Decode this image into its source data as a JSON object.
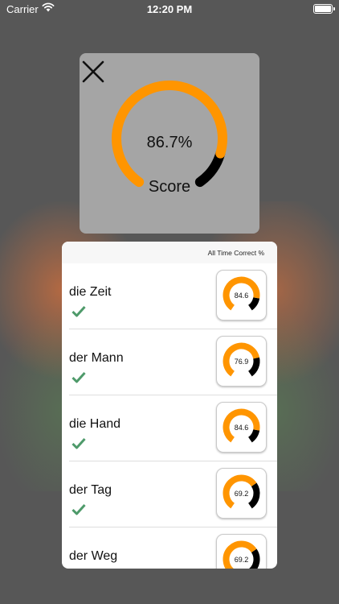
{
  "status_bar": {
    "carrier": "Carrier",
    "time": "12:20 PM",
    "wifi_icon": "wifi-icon",
    "battery_icon": "battery-icon"
  },
  "score": {
    "value": "86.7%",
    "label": "Score",
    "fraction": 0.867,
    "close_icon": "close-icon"
  },
  "stats": {
    "header": "All Time Correct %",
    "rows": [
      {
        "word": "die Zeit",
        "correct_pct": "84.6",
        "fraction": 0.846,
        "correct": true
      },
      {
        "word": "der Mann",
        "correct_pct": "76.9",
        "fraction": 0.769,
        "correct": true
      },
      {
        "word": "die Hand",
        "correct_pct": "84.6",
        "fraction": 0.846,
        "correct": true
      },
      {
        "word": "der Tag",
        "correct_pct": "69.2",
        "fraction": 0.692,
        "correct": true
      },
      {
        "word": "der Weg",
        "correct_pct": "69.2",
        "fraction": 0.692,
        "correct": null
      }
    ]
  },
  "colors": {
    "accent": "#FF9500",
    "remainder": "#000000",
    "check": "#4E9A6A",
    "card_bg": "#A5A5A5",
    "backdrop": "#575757"
  }
}
